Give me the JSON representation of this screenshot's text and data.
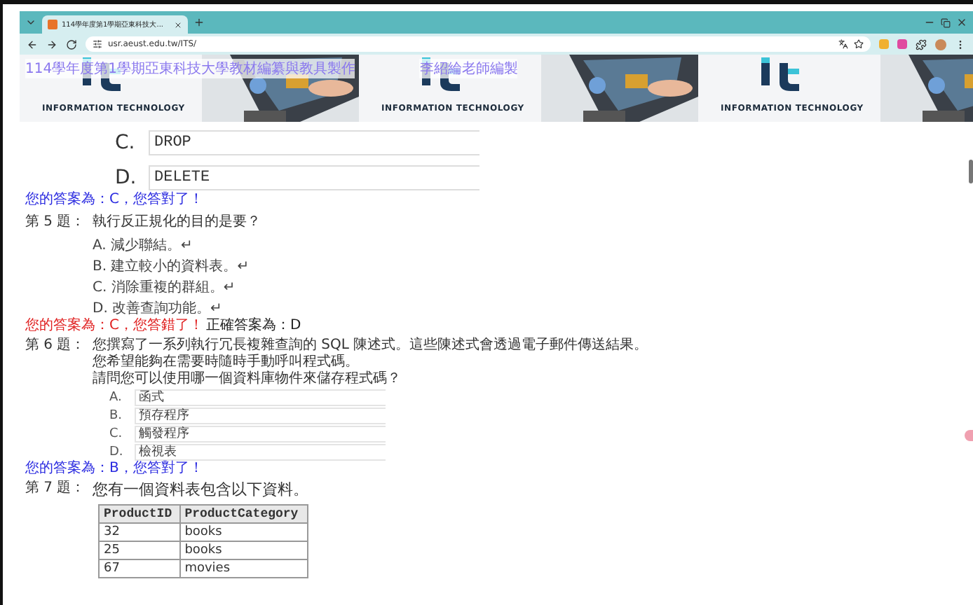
{
  "browser": {
    "tab_title": "114學年度第1學期亞東科技大...",
    "url": "usr.aeust.edu.tw/ITS/"
  },
  "banner": {
    "overlay_text": "114學年度第1學期亞東科技大學教材編纂與教具製作",
    "author_text": "李紹綸老師編製",
    "tiles": [
      {
        "brand": "INFORMATION TECHNOLOGY"
      },
      {
        "brand": "INFORMATION TECHNOLOGY"
      },
      {
        "brand": "INFORMATION TECHNOLOGY"
      }
    ]
  },
  "previous_options": [
    {
      "letter": "C.",
      "text": "DROP"
    },
    {
      "letter": "D.",
      "text": "DELETE"
    }
  ],
  "previous_feedback": {
    "correct": true,
    "text": "您的答案為：C，您答對了！"
  },
  "questions": [
    {
      "number": "第 5 題：",
      "kind": "plain",
      "prompt": [
        "執行反正規化的目的是要？"
      ],
      "options": [
        "A. 減少聯結。↵",
        "B. 建立較小的資料表。↵",
        "C. 消除重複的群組。↵",
        "D. 改善查詢功能。↵"
      ],
      "feedback": {
        "correct": false,
        "text": "您的答案為：C，您答錯了！",
        "extra": "正確答案為：D"
      }
    },
    {
      "number": "第 6 題：",
      "kind": "lined",
      "prompt": [
        "您撰寫了一系列執行冗長複雜查詢的 SQL 陳述式。這些陳述式會透過電子郵件傳送結果。",
        "您希望能夠在需要時隨時手動呼叫程式碼。",
        "請問您可以使用哪一個資料庫物件來儲存程式碼？"
      ],
      "options": [
        {
          "letter": "A.",
          "text": "函式"
        },
        {
          "letter": "B.",
          "text": "預存程序"
        },
        {
          "letter": "C.",
          "text": "觸發程序"
        },
        {
          "letter": "D.",
          "text": "檢視表"
        }
      ],
      "feedback": {
        "correct": true,
        "text": "您的答案為：B，您答對了！"
      }
    },
    {
      "number": "第 7 題：",
      "kind": "table",
      "prompt": [
        "您有一個資料表包含以下資料。"
      ],
      "table": {
        "columns": [
          "ProductID",
          "ProductCategory"
        ],
        "rows": [
          [
            "32",
            "books"
          ],
          [
            "25",
            "books"
          ],
          [
            "67",
            "movies"
          ]
        ]
      }
    }
  ]
}
